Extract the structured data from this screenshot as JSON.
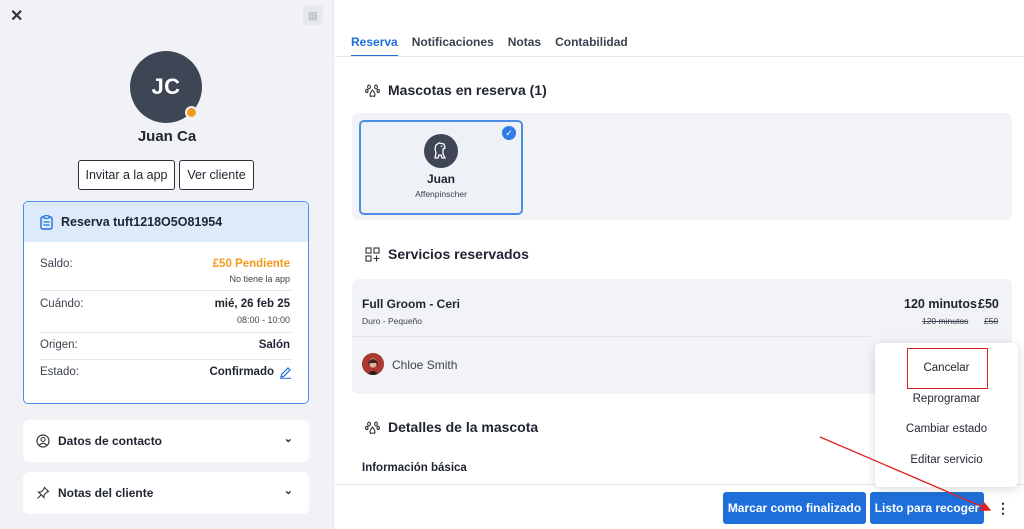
{
  "left": {
    "initials": "JC",
    "client_name": "Juan Ca",
    "invite_label": "Invitar a la app",
    "view_client_label": "Ver cliente",
    "reservation": {
      "title": "Reserva tuft1218O5O81954",
      "balance_label": "Saldo:",
      "balance_value": "£50 Pendiente",
      "balance_sub": "No tiene la app",
      "when_label": "Cuándo:",
      "when_value": "mié, 26 feb 25",
      "when_sub": "08:00 - 10:00",
      "origin_label": "Origen:",
      "origin_value": "Salón",
      "status_label": "Estado:",
      "status_value": "Confirmado"
    },
    "contact_label": "Datos de contacto",
    "notes_label": "Notas del cliente"
  },
  "tabs": [
    "Reserva",
    "Notificaciones",
    "Notas",
    "Contabilidad"
  ],
  "pets": {
    "title": "Mascotas en reserva (1)",
    "items": [
      {
        "name": "Juan",
        "breed": "Affenpinscher"
      }
    ]
  },
  "services": {
    "title": "Servicios reservados",
    "name": "Full Groom - Ceri",
    "sub": "Duro - Pequeño",
    "duration": "120 minutos",
    "price": "£50",
    "duration_old": "120 minutos",
    "price_old": "£50",
    "staff": "Chloe Smith"
  },
  "pet_details": {
    "title": "Detalles de la mascota",
    "basic_info": "Información básica"
  },
  "menu": {
    "items": [
      "Cancelar",
      "Reprogramar",
      "Cambiar estado",
      "Editar servicio"
    ]
  },
  "actions": {
    "finish_label": "Marcar como finalizado",
    "ready_label": "Listo para recoger"
  },
  "colors": {
    "primary": "#1e6fd9",
    "pending": "#f39a1b",
    "highlight": "#e02020"
  }
}
